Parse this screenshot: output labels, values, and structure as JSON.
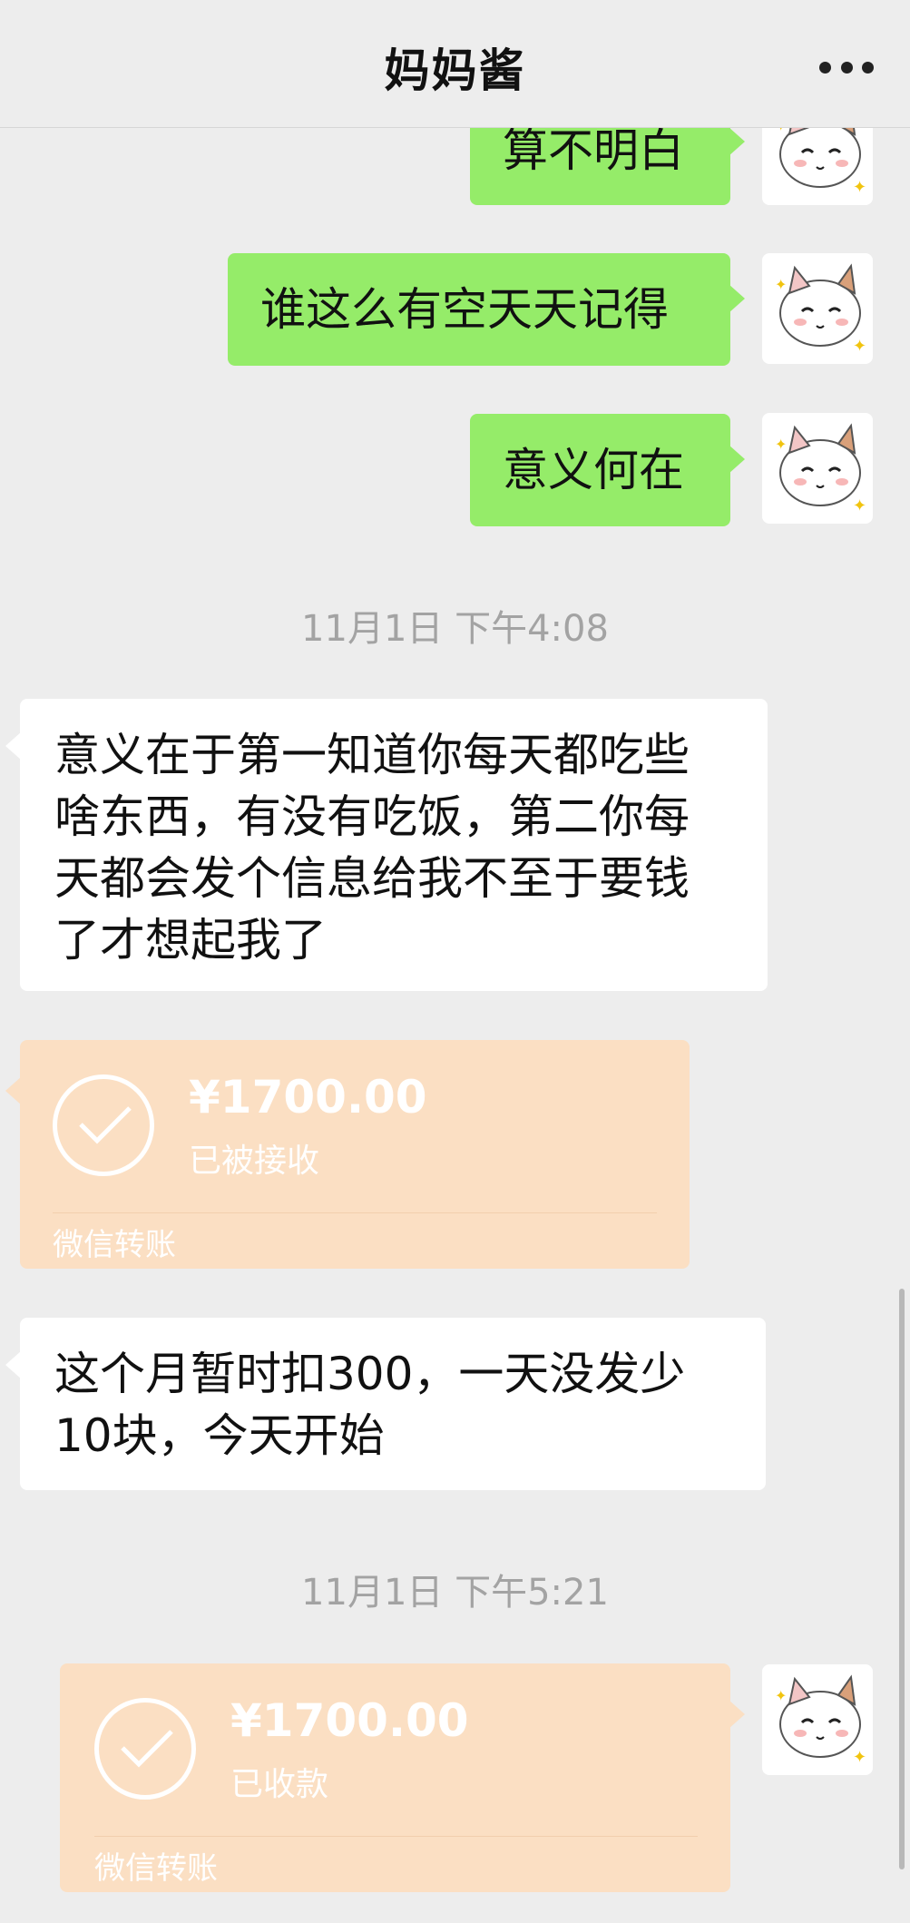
{
  "header": {
    "title": "妈妈酱"
  },
  "messages": [
    {
      "text": "算不明白"
    },
    {
      "text": "谁这么有空天天记得"
    },
    {
      "text": "意义何在"
    },
    {
      "timestamp": "11月1日 下午4:08"
    },
    {
      "line1": "意义在于第一知道你每天都吃些",
      "line2": "啥东西，有没有吃饭，第二你每",
      "line3": "天都会发个信息给我不至于要钱",
      "line4": "了才想起我了"
    },
    {
      "amount": "¥1700.00",
      "status": "已被接收",
      "footer": "微信转账"
    },
    {
      "line1": "这个月暂时扣300，一天没发少",
      "line2": "10块，今天开始"
    },
    {
      "timestamp": "11月1日 下午5:21"
    },
    {
      "amount": "¥1700.00",
      "status": "已收款",
      "footer": "微信转账"
    }
  ],
  "icons": {
    "more": "more-dots-icon",
    "check": "check-circle-icon",
    "avatar": "cartoon-cat-avatar"
  },
  "colors": {
    "sent_bubble": "#95ec69",
    "received_bubble": "#ffffff",
    "transfer_card": "#fbdfc3",
    "background": "#ededed"
  }
}
